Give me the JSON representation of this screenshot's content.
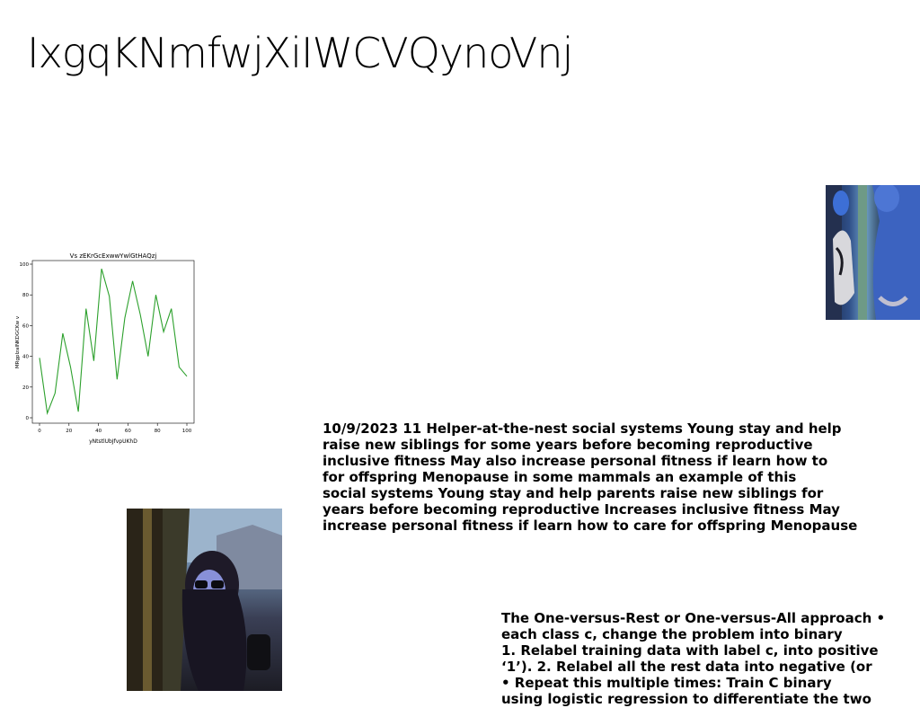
{
  "title": "IxgqKNmfwjXiIWCVQynoVnj",
  "chart_data": {
    "type": "line",
    "title": "Vs zEKrGcExwwYwlGtHAQzj",
    "xlabel": "yNtstlUbJfvpUKhD",
    "ylabel": "MRgpIzaINKDGCKw v",
    "xlim": [
      0,
      100
    ],
    "ylim": [
      0,
      100
    ],
    "x_ticks": [
      0,
      20,
      40,
      60,
      80,
      100
    ],
    "y_ticks": [
      0,
      20,
      40,
      60,
      80,
      100
    ],
    "grid": false,
    "color": "#2ca02c",
    "x": [
      0,
      5.26,
      10.53,
      15.79,
      21.05,
      26.32,
      31.58,
      36.84,
      42.11,
      47.37,
      52.63,
      57.89,
      63.16,
      68.42,
      73.68,
      78.95,
      84.21,
      89.47,
      94.74,
      100
    ],
    "values": [
      39,
      3,
      16,
      55,
      33,
      4,
      71,
      37,
      97,
      79,
      25,
      65,
      89,
      67,
      40,
      80,
      56,
      71,
      33,
      27
    ]
  },
  "paragraph1": [
    "10/9/2023 11 Helper-at-the-nest social systems Young stay and help",
    "raise new siblings for some years before becoming reproductive",
    "inclusive fitness May also increase personal fitness if learn how to",
    "for offspring Menopause in some mammals an example of this",
    "social systems Young stay and help parents raise new siblings for",
    "years before becoming reproductive Increases inclusive fitness May",
    "increase personal fitness if learn how to care for offspring Menopause"
  ],
  "paragraph2": [
    "The One-versus-Rest or One-versus-All approach •",
    "each class c, change the problem into binary",
    "1. Relabel training data with label c, into positive",
    "‘1’). 2. Relabel all the rest data into negative (or",
    "• Repeat this multiple times: Train C binary",
    "using logistic regression to differentiate the two"
  ]
}
